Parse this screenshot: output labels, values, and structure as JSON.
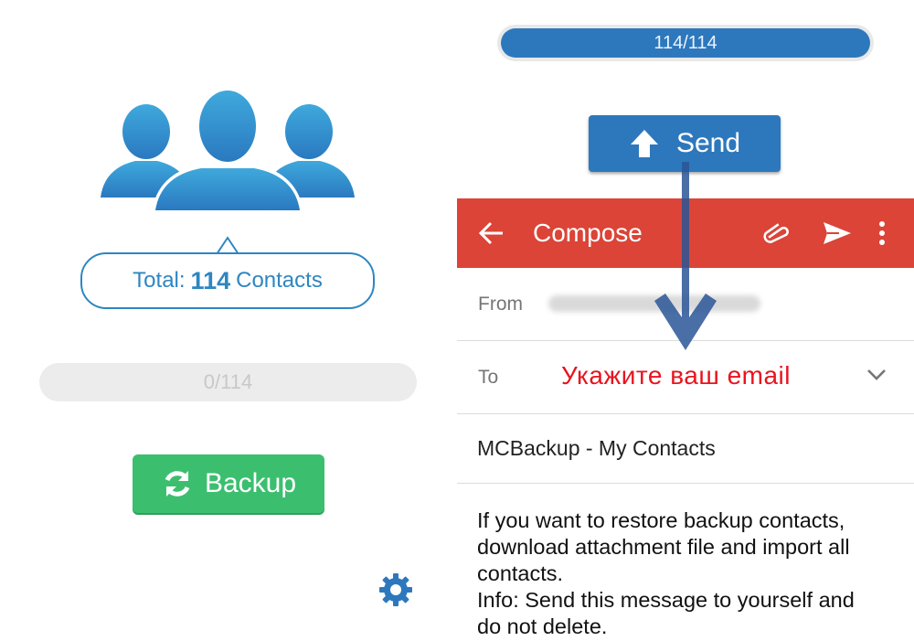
{
  "left_panel": {
    "total_prefix": "Total:",
    "total_count": "114",
    "total_suffix": "Contacts",
    "progress_text": "0/114",
    "backup_label": "Backup",
    "icons": {
      "contacts": "contacts-group-icon",
      "refresh": "refresh-icon",
      "settings": "gear-icon"
    }
  },
  "right_panel": {
    "progress_text": "114/114",
    "send_label": "Send",
    "compose": {
      "title": "Compose",
      "icons": [
        "back-arrow-icon",
        "attach-icon",
        "send-icon",
        "more-vert-icon"
      ]
    },
    "from_label": "From",
    "to_label": "To",
    "to_value": "Укажите ваш email",
    "subject": "MCBackup - My Contacts",
    "body_lines": [
      "If you want to restore backup contacts,",
      "download attachment file and import all",
      "contacts.",
      "Info: Send this message to yourself and",
      "do not delete."
    ]
  },
  "colors": {
    "primary_blue": "#2d78bd",
    "backup_green": "#3bbf6f",
    "compose_red": "#db4437",
    "hint_red": "#e8141e"
  }
}
